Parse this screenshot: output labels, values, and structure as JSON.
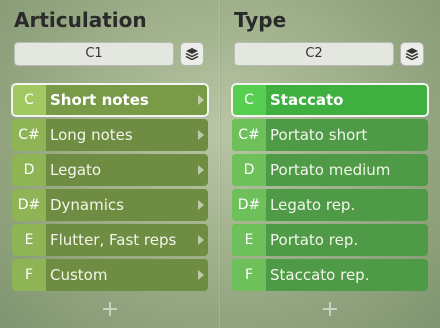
{
  "articulation": {
    "title": "Articulation",
    "selector_value": "C1",
    "items": [
      {
        "key": "C",
        "label": "Short notes"
      },
      {
        "key": "C#",
        "label": "Long notes"
      },
      {
        "key": "D",
        "label": "Legato"
      },
      {
        "key": "D#",
        "label": "Dynamics"
      },
      {
        "key": "E",
        "label": "Flutter, Fast reps"
      },
      {
        "key": "F",
        "label": "Custom"
      }
    ],
    "selected_index": 0,
    "add_label": "+"
  },
  "type": {
    "title": "Type",
    "selector_value": "C2",
    "items": [
      {
        "key": "C",
        "label": "Staccato"
      },
      {
        "key": "C#",
        "label": "Portato short"
      },
      {
        "key": "D",
        "label": "Portato medium"
      },
      {
        "key": "D#",
        "label": "Legato rep."
      },
      {
        "key": "E",
        "label": "Portato rep."
      },
      {
        "key": "F",
        "label": "Staccato rep."
      }
    ],
    "selected_index": 0,
    "add_label": "+"
  },
  "icons": {
    "layers": "layers-icon",
    "submenu_arrow": "chevron-right-icon"
  },
  "colors": {
    "articulation_item": "#6f8c43",
    "articulation_key": "#8eb456",
    "type_item": "#4f9a46",
    "type_key": "#6ec05a",
    "selected_outline": "#f4f4f0"
  }
}
